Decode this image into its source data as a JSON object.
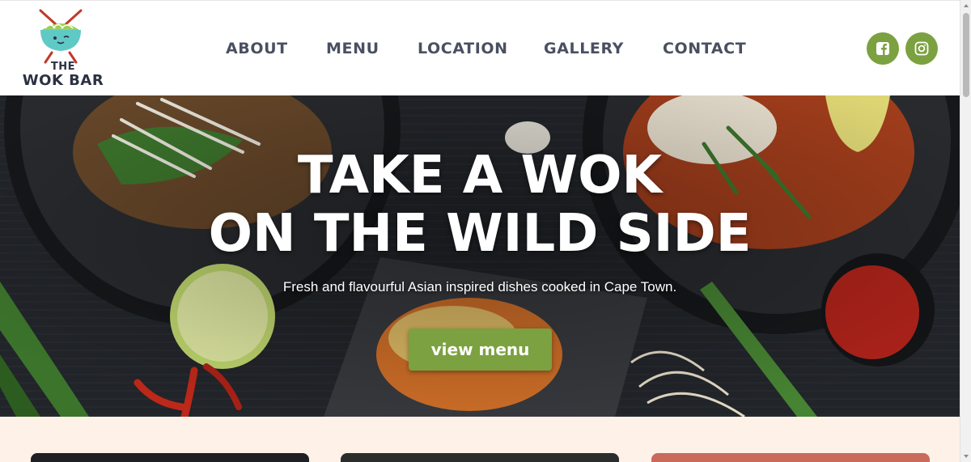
{
  "brand": {
    "logo_the": "THE",
    "logo_name": "WOK BAR",
    "accent_color": "#7ca140",
    "text_color": "#4a5061"
  },
  "nav": {
    "items": [
      {
        "label": "ABOUT"
      },
      {
        "label": "MENU"
      },
      {
        "label": "LOCATION"
      },
      {
        "label": "GALLERY"
      },
      {
        "label": "CONTACT"
      }
    ]
  },
  "social": {
    "icons": [
      "facebook-icon",
      "instagram-icon"
    ]
  },
  "hero": {
    "title_line1": "TAKE A WOK",
    "title_line2": "ON THE WILD SIDE",
    "subtitle": "Fresh and flavourful Asian inspired dishes cooked in Cape Town.",
    "button_label": "view menu"
  }
}
